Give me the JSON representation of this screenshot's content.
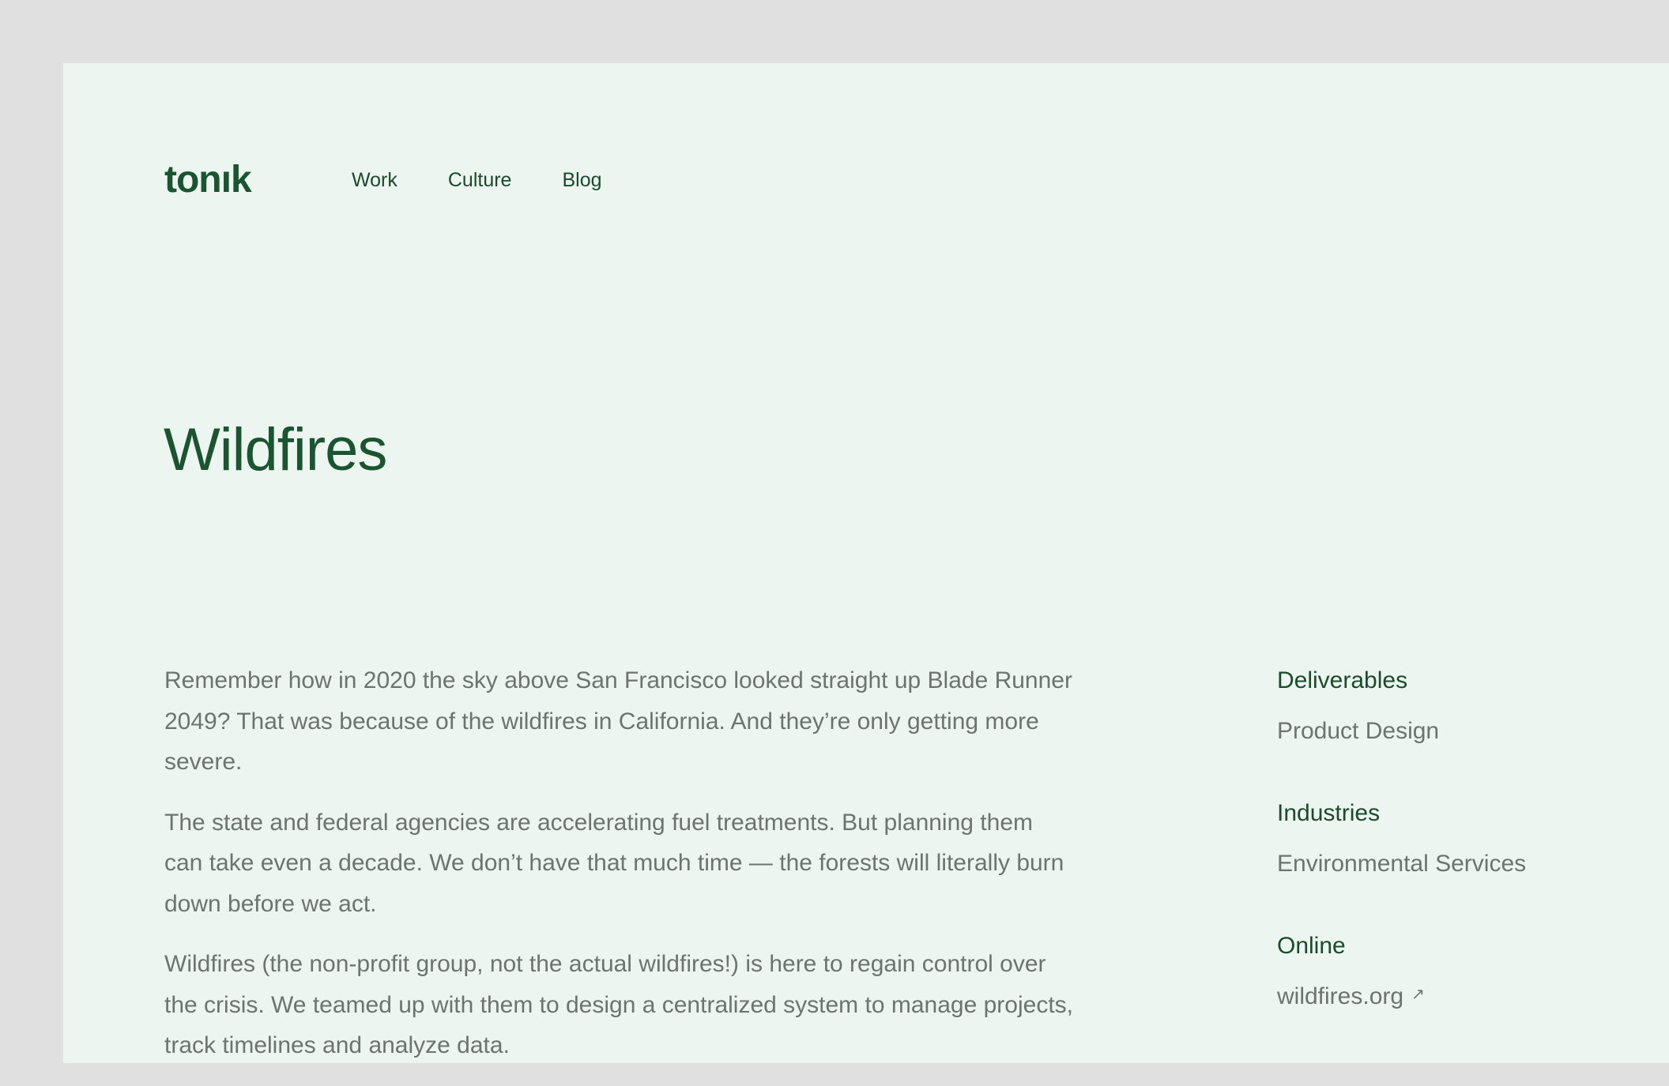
{
  "header": {
    "logo": "tonık",
    "nav": [
      "Work",
      "Culture",
      "Blog"
    ]
  },
  "main": {
    "title": "Wildfires",
    "paragraphs": [
      "Remember how in 2020 the sky above San Francisco looked straight up Blade Runner 2049? That was because of the wildfires in California. And they’re only getting more severe.",
      "The state and federal agencies are accelerating fuel treatments. But planning them can take even a decade. We don’t have that much time — the forests will literally burn down before we act.",
      "Wildfires (the non-profit group, not the actual wildfires!) is here to regain control over the crisis. We teamed up with them to design a centralized system to manage projects, track timelines and analyze data."
    ]
  },
  "meta": {
    "deliverables_label": "Deliverables",
    "deliverables_value": "Product Design",
    "industries_label": "Industries",
    "industries_value": "Environmental Services",
    "online_label": "Online",
    "online_value": "wildfires.org",
    "online_icon": "external-link-arrow-icon"
  },
  "colors": {
    "outer_background": "#e0e0e0",
    "page_background": "#ecf5f0",
    "brand_green": "#1b5430",
    "body_text": "#6d746f"
  }
}
